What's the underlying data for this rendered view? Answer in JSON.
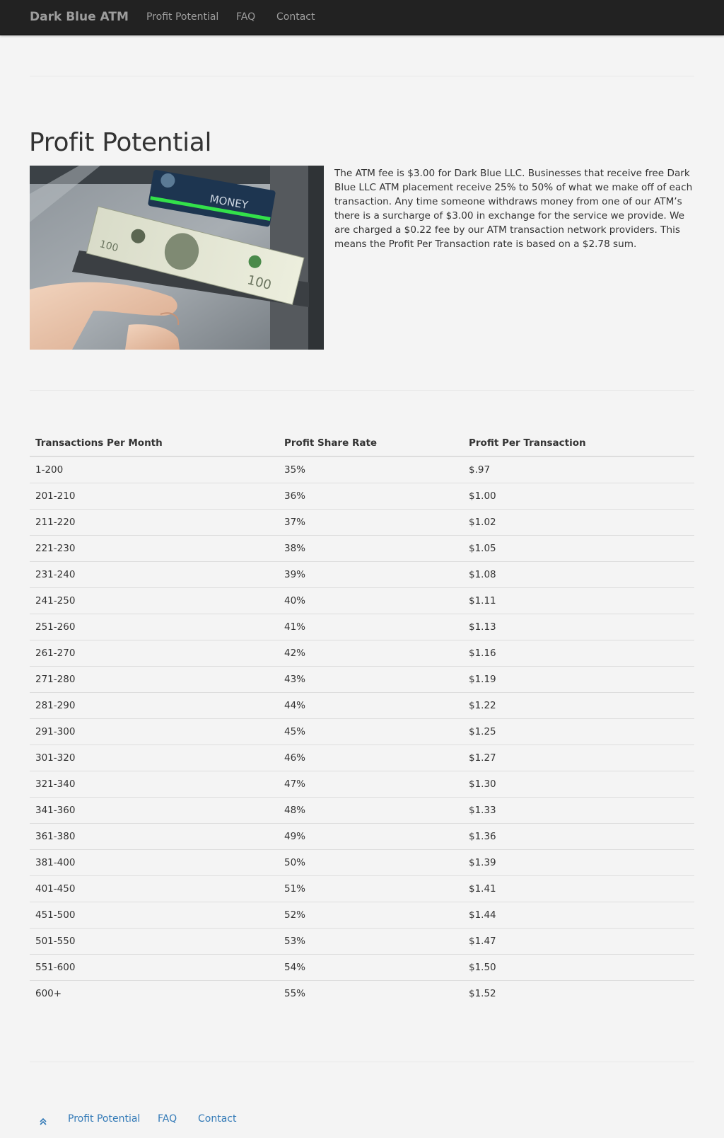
{
  "navbar": {
    "brand": "Dark Blue ATM",
    "links": [
      "Profit Potential",
      "FAQ",
      "Contact"
    ]
  },
  "page": {
    "title": "Profit Potential",
    "image_icon": "atm-cash-withdrawal-photo",
    "image_caption": "MONEY",
    "intro": "The ATM fee is $3.00 for Dark Blue LLC. Businesses that receive free Dark Blue LLC ATM placement receive 25% to 50% of what we make off of each transaction. Any time someone withdraws money from one of our ATM’s there is a surcharge of $3.00 in exchange for the service we provide. We are charged a $0.22 fee by our ATM transaction network providers. This means the Profit Per Transaction rate is based on a $2.78 sum."
  },
  "table": {
    "headers": [
      "Transactions Per Month",
      "Profit Share Rate",
      "Profit Per Transaction"
    ],
    "rows": [
      [
        "1-200",
        "35%",
        "$.97"
      ],
      [
        "201-210",
        "36%",
        "$1.00"
      ],
      [
        "211-220",
        "37%",
        "$1.02"
      ],
      [
        "221-230",
        "38%",
        "$1.05"
      ],
      [
        "231-240",
        "39%",
        "$1.08"
      ],
      [
        "241-250",
        "40%",
        "$1.11"
      ],
      [
        "251-260",
        "41%",
        "$1.13"
      ],
      [
        "261-270",
        "42%",
        "$1.16"
      ],
      [
        "271-280",
        "43%",
        "$1.19"
      ],
      [
        "281-290",
        "44%",
        "$1.22"
      ],
      [
        "291-300",
        "45%",
        "$1.25"
      ],
      [
        "301-320",
        "46%",
        "$1.27"
      ],
      [
        "321-340",
        "47%",
        "$1.30"
      ],
      [
        "341-360",
        "48%",
        "$1.33"
      ],
      [
        "361-380",
        "49%",
        "$1.36"
      ],
      [
        "381-400",
        "50%",
        "$1.39"
      ],
      [
        "401-450",
        "51%",
        "$1.41"
      ],
      [
        "451-500",
        "52%",
        "$1.44"
      ],
      [
        "501-550",
        "53%",
        "$1.47"
      ],
      [
        "551-600",
        "54%",
        "$1.50"
      ],
      [
        "600+",
        "55%",
        "$1.52"
      ]
    ]
  },
  "footer": {
    "top_icon": "double-chevron-up-icon",
    "links": [
      "Profit Potential",
      "FAQ",
      "Contact"
    ]
  },
  "colors": {
    "navbar_bg": "#222222",
    "nav_text": "#9d9d9d",
    "page_bg": "#f4f4f4",
    "link": "#337ab7",
    "text": "#333333"
  }
}
